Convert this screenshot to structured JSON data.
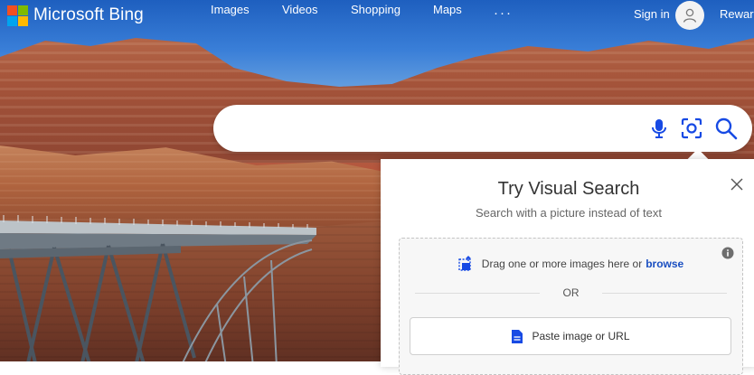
{
  "brand": {
    "name": "Microsoft Bing"
  },
  "nav": {
    "images": "Images",
    "videos": "Videos",
    "shopping": "Shopping",
    "maps": "Maps",
    "more": "···"
  },
  "account": {
    "signin": "Sign in",
    "rewards": "Rewar"
  },
  "search": {
    "value": "",
    "placeholder": ""
  },
  "icons": {
    "logo": "microsoft-logo-icon",
    "avatar": "user-avatar-icon",
    "mic": "microphone-icon",
    "camera": "visual-search-icon",
    "search": "magnifier-icon",
    "close": "close-icon",
    "info": "info-icon",
    "upload": "image-upload-icon",
    "document": "document-icon"
  },
  "visual_search": {
    "title": "Try Visual Search",
    "subtitle": "Search with a picture instead of text",
    "drag_text": "Drag one or more images here or",
    "browse": "browse",
    "or": "OR",
    "paste": "Paste image or URL"
  },
  "colors": {
    "accent_blue": "#1a4fc1",
    "ms_red": "#f25022",
    "ms_green": "#7fba00",
    "ms_blue": "#00a4ef",
    "ms_yellow": "#ffb900"
  }
}
